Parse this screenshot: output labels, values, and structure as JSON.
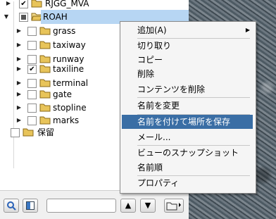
{
  "tree": {
    "items": [
      {
        "label": "RJGG_MVA",
        "checked": true
      },
      {
        "label": "ROAH",
        "selected": true
      },
      {
        "label": "grass",
        "checked": false
      },
      {
        "label": "taxiway",
        "checked": false
      },
      {
        "label": "runway",
        "checked": false
      },
      {
        "label": "taxiline",
        "checked": true
      },
      {
        "label": "terminal",
        "checked": false
      },
      {
        "label": "gate",
        "checked": false
      },
      {
        "label": "stopline",
        "checked": false
      },
      {
        "label": "marks",
        "checked": false
      },
      {
        "label": "保留",
        "checked": false
      }
    ]
  },
  "context_menu": {
    "items": [
      {
        "label": "追加(A)",
        "submenu": true
      },
      {
        "label": "切り取り"
      },
      {
        "label": "コピー"
      },
      {
        "label": "削除"
      },
      {
        "label": "コンテンツを削除"
      },
      {
        "label": "名前を変更"
      },
      {
        "label": "名前を付けて場所を保存",
        "highlighted": true
      },
      {
        "label": "メール..."
      },
      {
        "label": "ビューのスナップショット"
      },
      {
        "label": "名前順"
      },
      {
        "label": "プロパティ"
      }
    ]
  },
  "bottom": {
    "search_value": ""
  },
  "colors": {
    "selection": "#b7d6f3",
    "menu_highlight": "#3a6ea5",
    "folder": "#e8c45a"
  }
}
